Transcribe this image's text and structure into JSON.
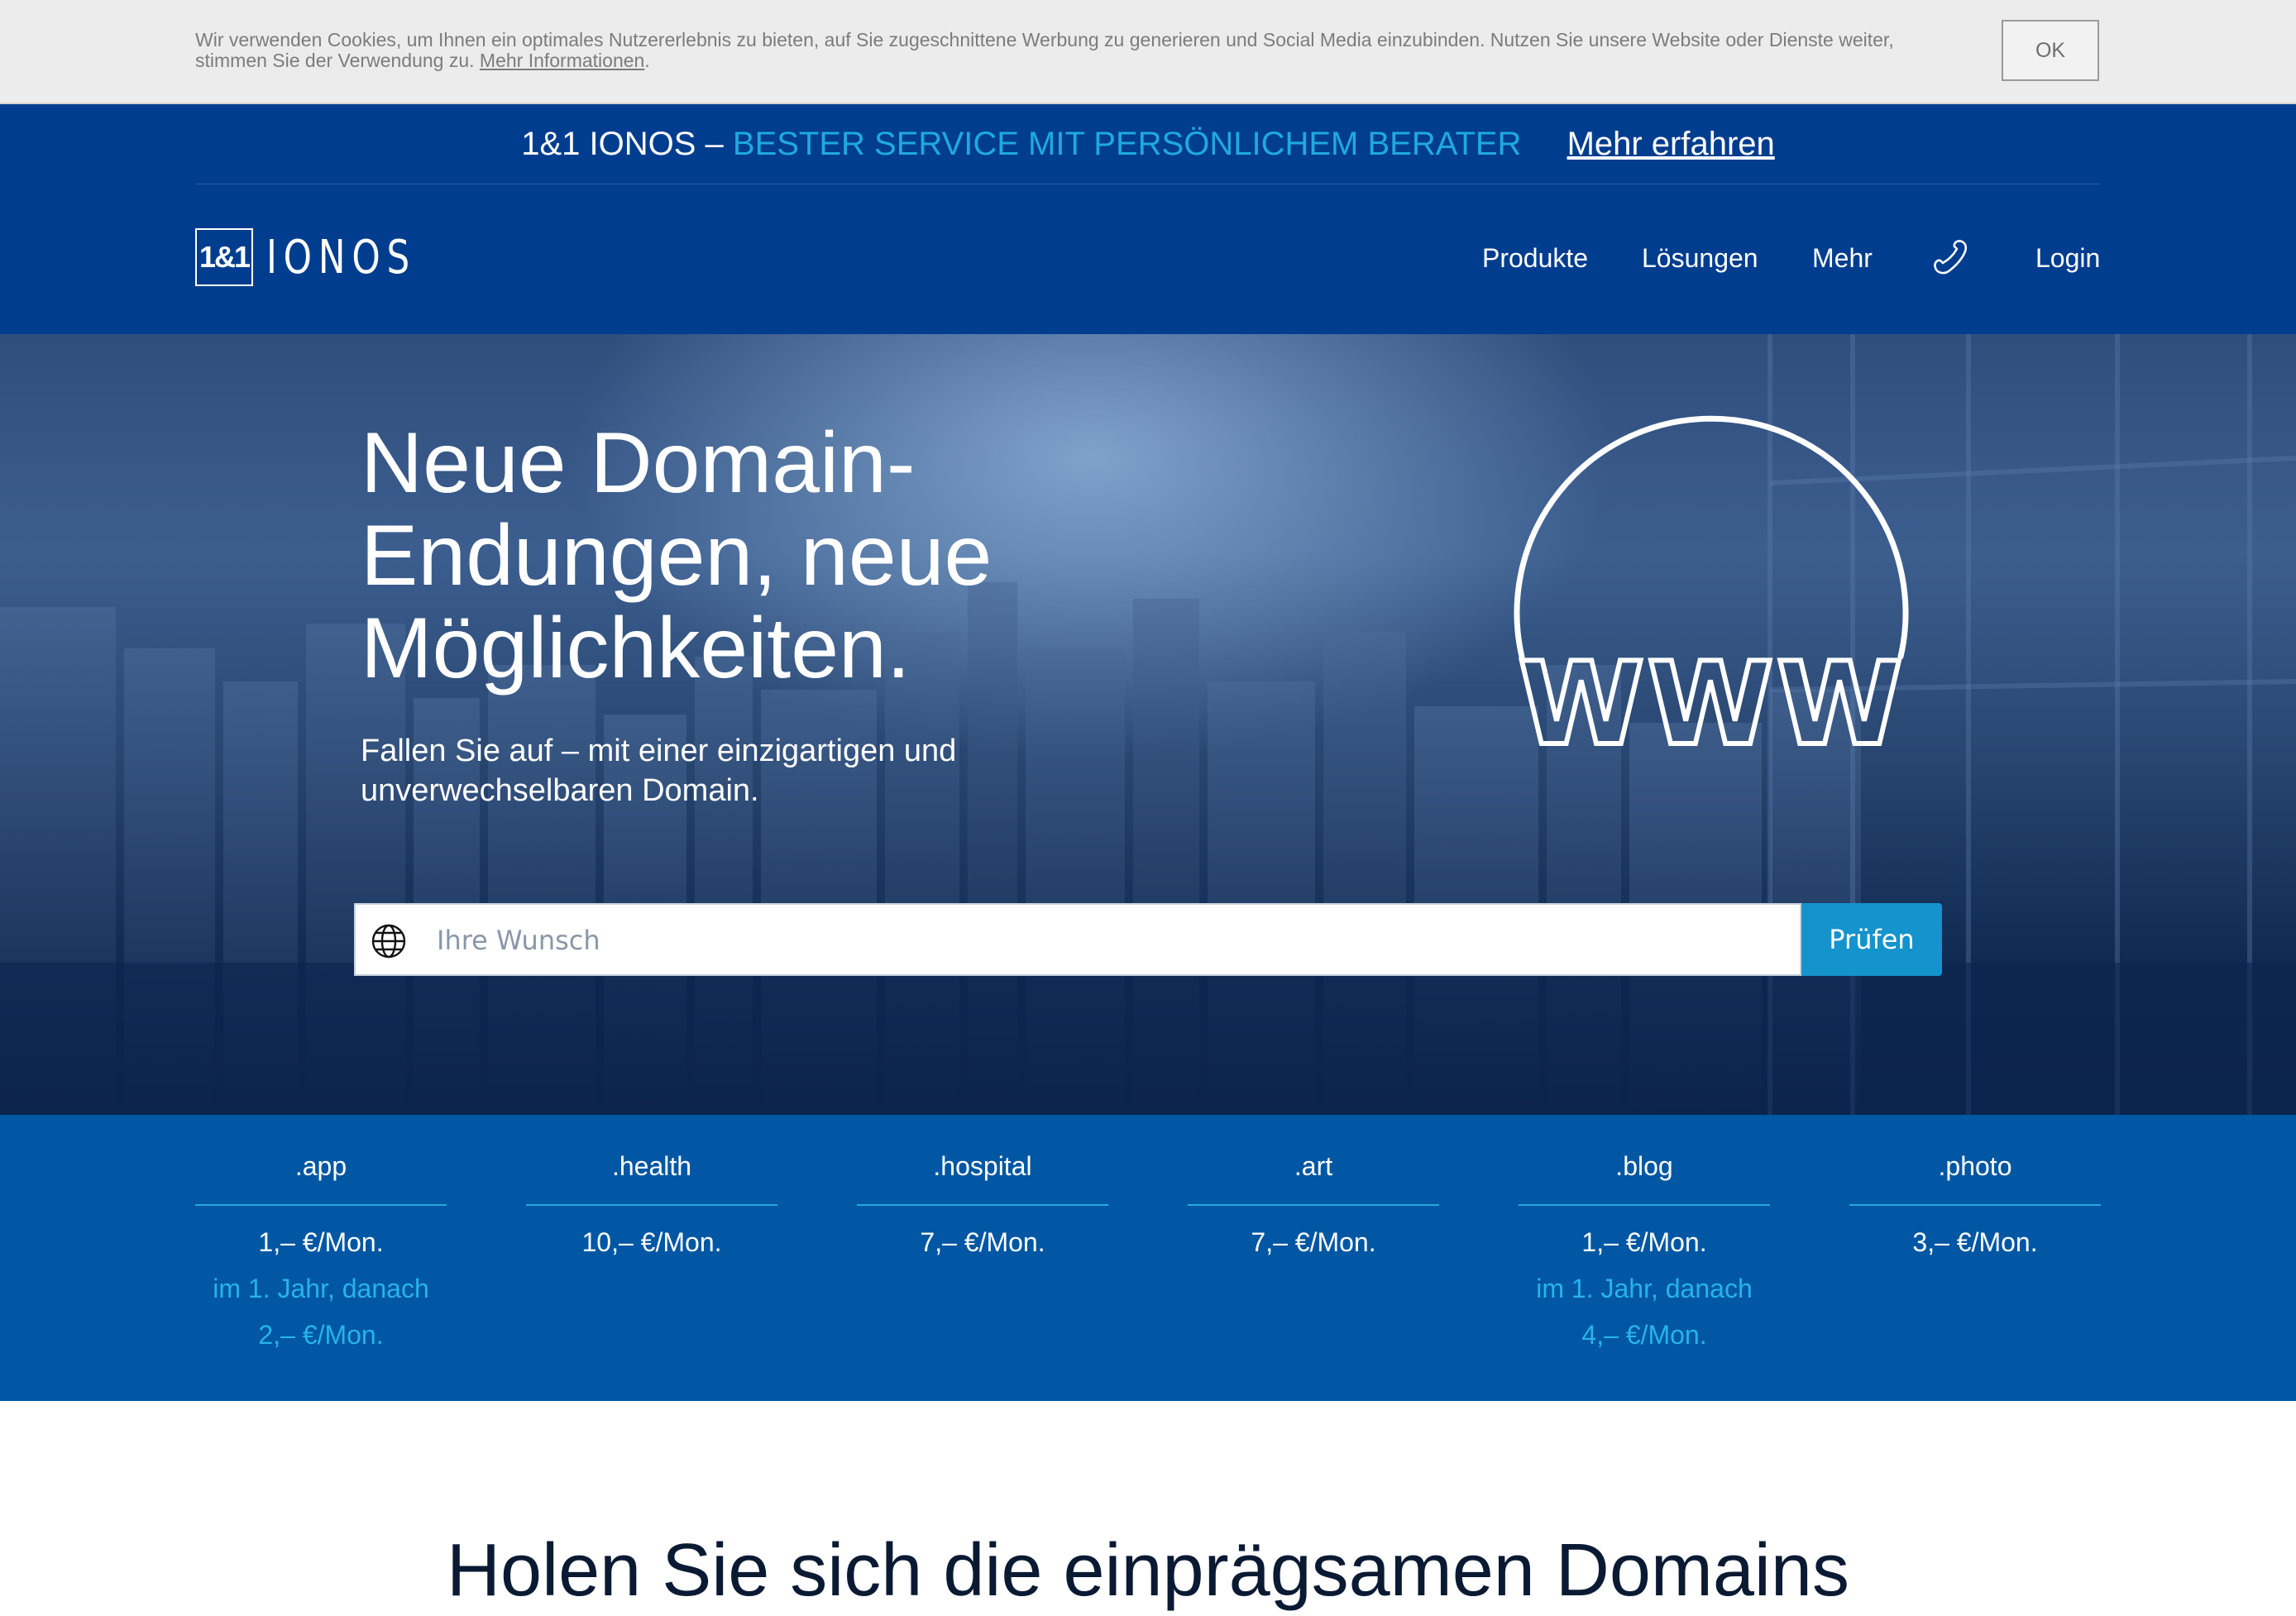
{
  "cookie_bar": {
    "text": "Wir verwenden Cookies, um Ihnen ein optimales Nutzererlebnis zu bieten, auf Sie zugeschnittene Werbung zu generieren und Social Media einzubinden. Nutzen Sie unsere Website oder Dienste weiter, stimmen Sie der Verwendung zu.",
    "link": "Mehr Informationen",
    "end": ".",
    "ok_label": "OK"
  },
  "promo": {
    "prefix": "1&1 IONOS –",
    "highlight": "BESTER SERVICE MIT PERSÖNLICHEM BERATER",
    "link": "Mehr erfahren"
  },
  "logo": {
    "mark": "1&1",
    "word": "IONOS"
  },
  "nav": {
    "items": [
      "Produkte",
      "Lösungen",
      "Mehr"
    ],
    "phone_icon": "phone-icon",
    "login": "Login"
  },
  "hero": {
    "title_lines": [
      "Neue Domain-",
      "Endungen, neue",
      "Möglichkeiten."
    ],
    "subtitle_lines": [
      "Fallen Sie auf – mit einer einzigartigen und",
      "unverwechselbaren Domain."
    ],
    "graphic_text": "WWW",
    "search": {
      "icon": "globe-icon",
      "placeholder": "Ihre Wunsch",
      "value": "",
      "button": "Prüfen"
    }
  },
  "tlds": [
    {
      "name": ".app",
      "price": "1,– €/Mon.",
      "note": "im 1. Jahr, danach",
      "later": "2,– €/Mon."
    },
    {
      "name": ".health",
      "price": "10,– €/Mon.",
      "note": "",
      "later": ""
    },
    {
      "name": ".hospital",
      "price": "7,– €/Mon.",
      "note": "",
      "later": ""
    },
    {
      "name": ".art",
      "price": "7,– €/Mon.",
      "note": "",
      "later": ""
    },
    {
      "name": ".blog",
      "price": "1,– €/Mon.",
      "note": "im 1. Jahr, danach",
      "later": "4,– €/Mon."
    },
    {
      "name": ".photo",
      "price": "3,– €/Mon.",
      "note": "",
      "later": ""
    }
  ],
  "lower_heading": "Holen Sie sich die einprägsamen Domains",
  "colors": {
    "header_bg": "#003d8f",
    "accent_cyan": "#1fa9e1",
    "tld_strip_bg": "#0157a3",
    "button_bg": "#1593cc",
    "cookie_bg": "#ececec"
  }
}
